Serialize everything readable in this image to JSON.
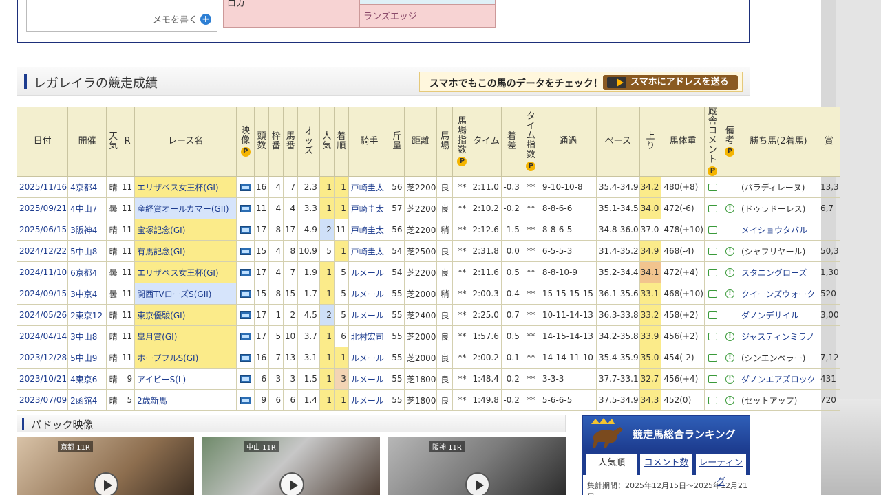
{
  "memo": {
    "link_label": "メモを書く"
  },
  "pink_cells": {
    "left": "ロカ",
    "right_bottom": "ランズエッジ"
  },
  "section": {
    "title": "レガレイラの競走成績",
    "banner_text": "スマホでもこの馬のデータをチェック！",
    "banner_button": "スマホにアドレスを送る"
  },
  "table": {
    "headers": [
      "日付",
      "開催",
      "天気",
      "R",
      "レース名",
      "映像",
      "頭数",
      "枠番",
      "馬番",
      "オッズ",
      "人気",
      "着順",
      "騎手",
      "斤量",
      "距離",
      "馬場",
      "馬場指数",
      "タイム",
      "着差",
      "タイム指数",
      "通過",
      "ペース",
      "上り",
      "馬体重",
      "厩舎コメント",
      "備考",
      "勝ち馬(2着馬)",
      "賞"
    ],
    "p_mark": "P",
    "rows": [
      {
        "date": "2025/11/16",
        "venue": "4京都4",
        "weather": "晴",
        "r": "11",
        "race": "エリザベス女王杯(GI)",
        "grade": "g1",
        "heads": "16",
        "waku": "4",
        "uma": "7",
        "odds": "2.3",
        "pop": "1",
        "place": "1",
        "jockey": "戸崎圭太",
        "weight": "56",
        "dist": "芝2200",
        "baba": "良",
        "index": "**",
        "time": "2:11.0",
        "diff": "-0.3",
        "tindex": "**",
        "pass": "9-10-10-8",
        "pace": "35.4-34.9",
        "agari": "34.2",
        "bw": "480(+8)",
        "note": false,
        "winner": "(パラディレーヌ)",
        "prize": "13,3"
      },
      {
        "date": "2025/09/21",
        "venue": "4中山7",
        "weather": "曇",
        "r": "11",
        "race": "産経賞オールカマー(GII)",
        "grade": "g2",
        "heads": "11",
        "waku": "4",
        "uma": "4",
        "odds": "3.3",
        "pop": "1",
        "place": "1",
        "jockey": "戸崎圭太",
        "weight": "57",
        "dist": "芝2200",
        "baba": "良",
        "index": "**",
        "time": "2:10.2",
        "diff": "-0.2",
        "tindex": "**",
        "pass": "8-8-6-6",
        "pace": "35.1-34.5",
        "agari": "34.0",
        "bw": "472(-6)",
        "note": true,
        "winner": "(ドゥラドーレス)",
        "prize": "6,7"
      },
      {
        "date": "2025/06/15",
        "venue": "3阪神4",
        "weather": "晴",
        "r": "11",
        "race": "宝塚記念(GI)",
        "grade": "g1",
        "heads": "17",
        "waku": "8",
        "uma": "17",
        "odds": "4.9",
        "pop": "2",
        "place": "11",
        "jockey": "戸崎圭太",
        "weight": "56",
        "dist": "芝2200",
        "baba": "稍",
        "index": "**",
        "time": "2:12.6",
        "diff": "1.5",
        "tindex": "**",
        "pass": "8-8-6-5",
        "pace": "34.8-36.0",
        "agari": "37.0",
        "bw": "478(+10)",
        "note": false,
        "winner": "メイショウタバル",
        "prize": ""
      },
      {
        "date": "2024/12/22",
        "venue": "5中山8",
        "weather": "晴",
        "r": "11",
        "race": "有馬記念(GI)",
        "grade": "g1",
        "heads": "15",
        "waku": "4",
        "uma": "8",
        "odds": "10.9",
        "pop": "5",
        "place": "1",
        "jockey": "戸崎圭太",
        "weight": "54",
        "dist": "芝2500",
        "baba": "良",
        "index": "**",
        "time": "2:31.8",
        "diff": "0.0",
        "tindex": "**",
        "pass": "6-5-5-3",
        "pace": "31.4-35.2",
        "agari": "34.9",
        "bw": "468(-4)",
        "note": true,
        "winner": "(シャフリヤール)",
        "prize": "50,3"
      },
      {
        "date": "2024/11/10",
        "venue": "6京都4",
        "weather": "曇",
        "r": "11",
        "race": "エリザベス女王杯(GI)",
        "grade": "g1",
        "heads": "17",
        "waku": "4",
        "uma": "7",
        "odds": "1.9",
        "pop": "1",
        "place": "5",
        "jockey": "ルメール",
        "weight": "54",
        "dist": "芝2200",
        "baba": "良",
        "index": "**",
        "time": "2:11.6",
        "diff": "0.5",
        "tindex": "**",
        "pass": "8-8-10-9",
        "pace": "35.2-34.4",
        "agari": "34.1",
        "bw": "472(+4)",
        "note": true,
        "winner": "スタニングローズ",
        "prize": "1,30"
      },
      {
        "date": "2024/09/15",
        "venue": "3中京4",
        "weather": "曇",
        "r": "11",
        "race": "関西TVローズS(GII)",
        "grade": "g2",
        "heads": "15",
        "waku": "8",
        "uma": "15",
        "odds": "1.7",
        "pop": "1",
        "place": "5",
        "jockey": "ルメール",
        "weight": "55",
        "dist": "芝2000",
        "baba": "稍",
        "index": "**",
        "time": "2:00.3",
        "diff": "0.4",
        "tindex": "**",
        "pass": "15-15-15-15",
        "pace": "36.1-35.6",
        "agari": "33.1",
        "bw": "468(+10)",
        "note": true,
        "winner": "クイーンズウォーク",
        "prize": "520"
      },
      {
        "date": "2024/05/26",
        "venue": "2東京12",
        "weather": "晴",
        "r": "11",
        "race": "東京優駿(GI)",
        "grade": "g1",
        "heads": "17",
        "waku": "1",
        "uma": "2",
        "odds": "4.5",
        "pop": "2",
        "place": "5",
        "jockey": "ルメール",
        "weight": "55",
        "dist": "芝2400",
        "baba": "良",
        "index": "**",
        "time": "2:25.0",
        "diff": "0.7",
        "tindex": "**",
        "pass": "10-11-14-13",
        "pace": "36.3-33.8",
        "agari": "33.2",
        "bw": "458(+2)",
        "note": false,
        "winner": "ダノンデサイル",
        "prize": "3,00"
      },
      {
        "date": "2024/04/14",
        "venue": "3中山8",
        "weather": "晴",
        "r": "11",
        "race": "皐月賞(GI)",
        "grade": "g1",
        "heads": "17",
        "waku": "5",
        "uma": "10",
        "odds": "3.7",
        "pop": "1",
        "place": "6",
        "jockey": "北村宏司",
        "weight": "55",
        "dist": "芝2000",
        "baba": "良",
        "index": "**",
        "time": "1:57.6",
        "diff": "0.5",
        "tindex": "**",
        "pass": "14-15-14-13",
        "pace": "34.2-35.8",
        "agari": "33.9",
        "bw": "456(+2)",
        "note": true,
        "winner": "ジャスティンミラノ",
        "prize": ""
      },
      {
        "date": "2023/12/28",
        "venue": "5中山9",
        "weather": "晴",
        "r": "11",
        "race": "ホープフルS(GI)",
        "grade": "g1",
        "heads": "16",
        "waku": "7",
        "uma": "13",
        "odds": "3.1",
        "pop": "1",
        "place": "1",
        "jockey": "ルメール",
        "weight": "55",
        "dist": "芝2000",
        "baba": "良",
        "index": "**",
        "time": "2:00.2",
        "diff": "-0.1",
        "tindex": "**",
        "pass": "14-14-11-10",
        "pace": "35.4-35.9",
        "agari": "35.0",
        "bw": "454(-2)",
        "note": true,
        "winner": "(シンエンペラー)",
        "prize": "7,12"
      },
      {
        "date": "2023/10/21",
        "venue": "4東京6",
        "weather": "晴",
        "r": "9",
        "race": "アイビーS(L)",
        "grade": "",
        "heads": "6",
        "waku": "3",
        "uma": "3",
        "odds": "1.5",
        "pop": "1",
        "place": "3",
        "jockey": "ルメール",
        "weight": "55",
        "dist": "芝1800",
        "baba": "良",
        "index": "**",
        "time": "1:48.4",
        "diff": "0.2",
        "tindex": "**",
        "pass": "3-3-3",
        "pace": "37.7-33.1",
        "agari": "32.7",
        "bw": "456(+4)",
        "note": true,
        "winner": "ダノンエアズロック",
        "prize": "431"
      },
      {
        "date": "2023/07/09",
        "venue": "2函館4",
        "weather": "晴",
        "r": "5",
        "race": "2歳新馬",
        "grade": "",
        "heads": "9",
        "waku": "6",
        "uma": "6",
        "odds": "1.4",
        "pop": "1",
        "place": "1",
        "jockey": "ルメール",
        "weight": "55",
        "dist": "芝1800",
        "baba": "良",
        "index": "**",
        "time": "1:49.8",
        "diff": "-0.2",
        "tindex": "**",
        "pass": "5-6-6-5",
        "pace": "37.5-34.9",
        "agari": "34.3",
        "bw": "452(0)",
        "note": true,
        "winner": "(セットアップ)",
        "prize": "720"
      }
    ]
  },
  "paddock": {
    "title": "パドック映像",
    "thumbs": [
      "京都 11R",
      "中山 11R",
      "阪神 11R"
    ]
  },
  "ranking": {
    "title": "競走馬総合ランキング",
    "tabs": [
      "人気順",
      "コメント数",
      "レーティング"
    ],
    "period": "集計期間：2025年12月15日～2025年12月21日"
  }
}
